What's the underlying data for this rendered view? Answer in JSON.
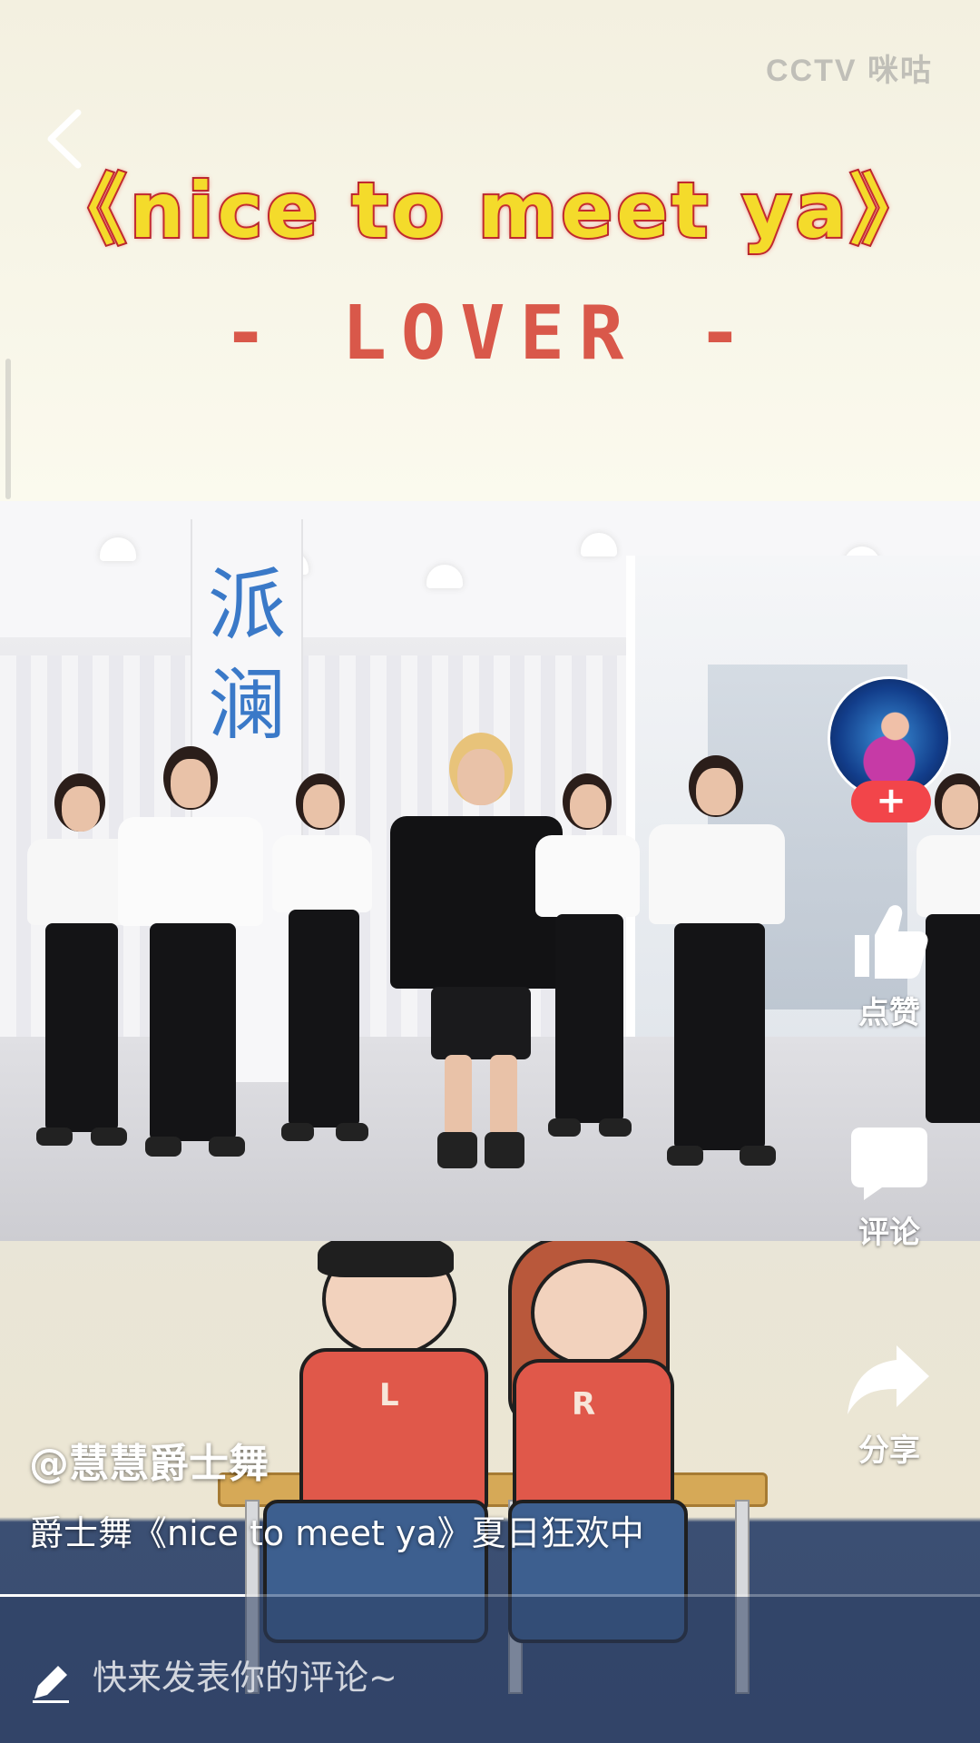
{
  "banner": {
    "watermark": "CCTV 咪咕",
    "song_title": "《nice to meet ya》",
    "subtitle": "- LOVER -"
  },
  "video": {
    "pillar_text": "派\n澜"
  },
  "cartoon": {
    "left_letter": "L",
    "right_letter": "R"
  },
  "actions": {
    "follow_symbol": "+",
    "like_label": "点赞",
    "comment_label": "评论",
    "share_label": "分享"
  },
  "post": {
    "author": "@慧慧爵士舞",
    "caption": "爵士舞《nice to meet ya》夏日狂欢中",
    "progress": 0.25
  },
  "comment_bar": {
    "placeholder": "快来发表你的评论~"
  },
  "icons": {
    "back": "chevron-left-icon",
    "like": "thumbs-up-icon",
    "comment": "chat-bubble-icon",
    "share": "share-arrow-icon",
    "edit": "pencil-icon"
  },
  "colors": {
    "title_fill": "#f4db2b",
    "title_stroke": "#b0222a",
    "subtitle": "#d9584a",
    "follow": "#f2454a",
    "pillar_text": "#3a79c8"
  }
}
